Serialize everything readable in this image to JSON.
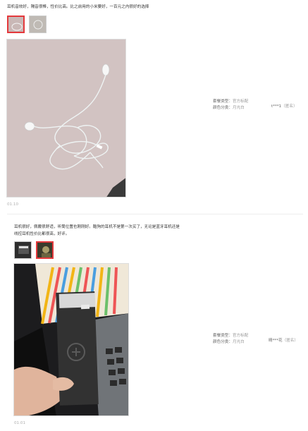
{
  "reviews": [
    {
      "text": "耳机音效好，隔音很棒，性价比高。比之前用的小米要好，一百元之内很好的选择",
      "date": "01.10",
      "attrs": [
        {
          "label": "套餐类型：",
          "value": "官方标配"
        },
        {
          "label": "颜色分类：",
          "value": "月光白"
        }
      ],
      "user": "t***1",
      "anonymous": "（匿名）"
    },
    {
      "text_lines": [
        "耳机很好，佩戴很舒适，听筒位置也刚刚好。酷狗的耳机不是第一次买了，无论是蓝牙耳机还是",
        "线控耳机性价比都很高，好评。"
      ],
      "date": "01.01",
      "attrs": [
        {
          "label": "套餐类型：",
          "value": "官方标配"
        },
        {
          "label": "颜色分类：",
          "value": "月光白"
        }
      ],
      "user": "晴***花",
      "anonymous": "（匿名）"
    }
  ],
  "colors": {
    "accent": "#e4393c",
    "date": "#b0b0b0"
  },
  "icons": [
    "earphone-photo",
    "product-box-photo"
  ]
}
